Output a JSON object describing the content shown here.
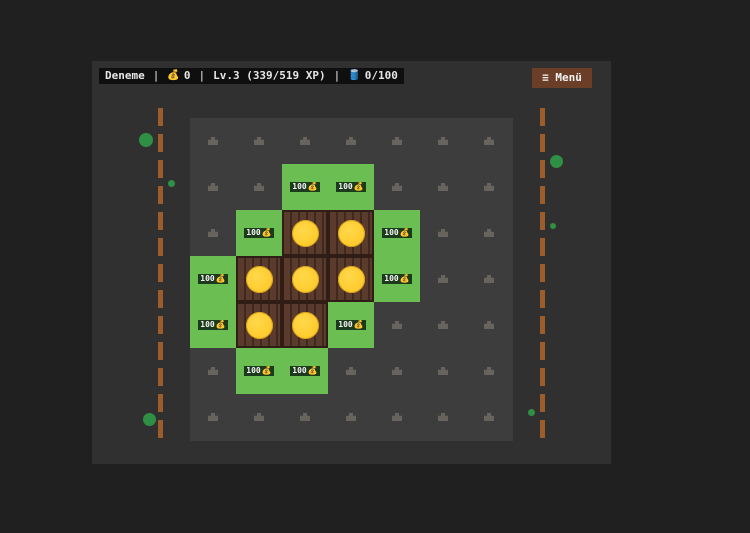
{
  "hud": {
    "farm_name": "Deneme",
    "separator": "|",
    "money_icon": "💰",
    "money": "0",
    "level_text": "Lv.3 (339/519 XP)",
    "storage_icon": "🛢️",
    "storage": "0/100"
  },
  "menu": {
    "label": "≡ Menü"
  },
  "board": {
    "rows": [
      [
        "empty",
        "empty",
        "empty",
        "empty",
        "empty",
        "empty",
        "empty"
      ],
      [
        "empty",
        "empty",
        "buy",
        "buy",
        "empty",
        "empty",
        "empty"
      ],
      [
        "empty",
        "buy",
        "owned",
        "owned",
        "buy",
        "empty",
        "empty"
      ],
      [
        "buy",
        "owned",
        "owned",
        "owned",
        "buy",
        "empty",
        "empty"
      ],
      [
        "buy",
        "owned",
        "owned",
        "buy",
        "empty",
        "empty",
        "empty"
      ],
      [
        "empty",
        "buy",
        "buy",
        "empty",
        "empty",
        "empty",
        "empty"
      ],
      [
        "empty",
        "empty",
        "empty",
        "empty",
        "empty",
        "empty",
        "empty"
      ]
    ],
    "buy_price": "100",
    "buy_currency_icon": "💰"
  },
  "colors": {
    "buyable": "#6bbf52",
    "coin": "#ffcc2e",
    "fence": "#9b5d2c",
    "menu": "#6b3f27"
  }
}
